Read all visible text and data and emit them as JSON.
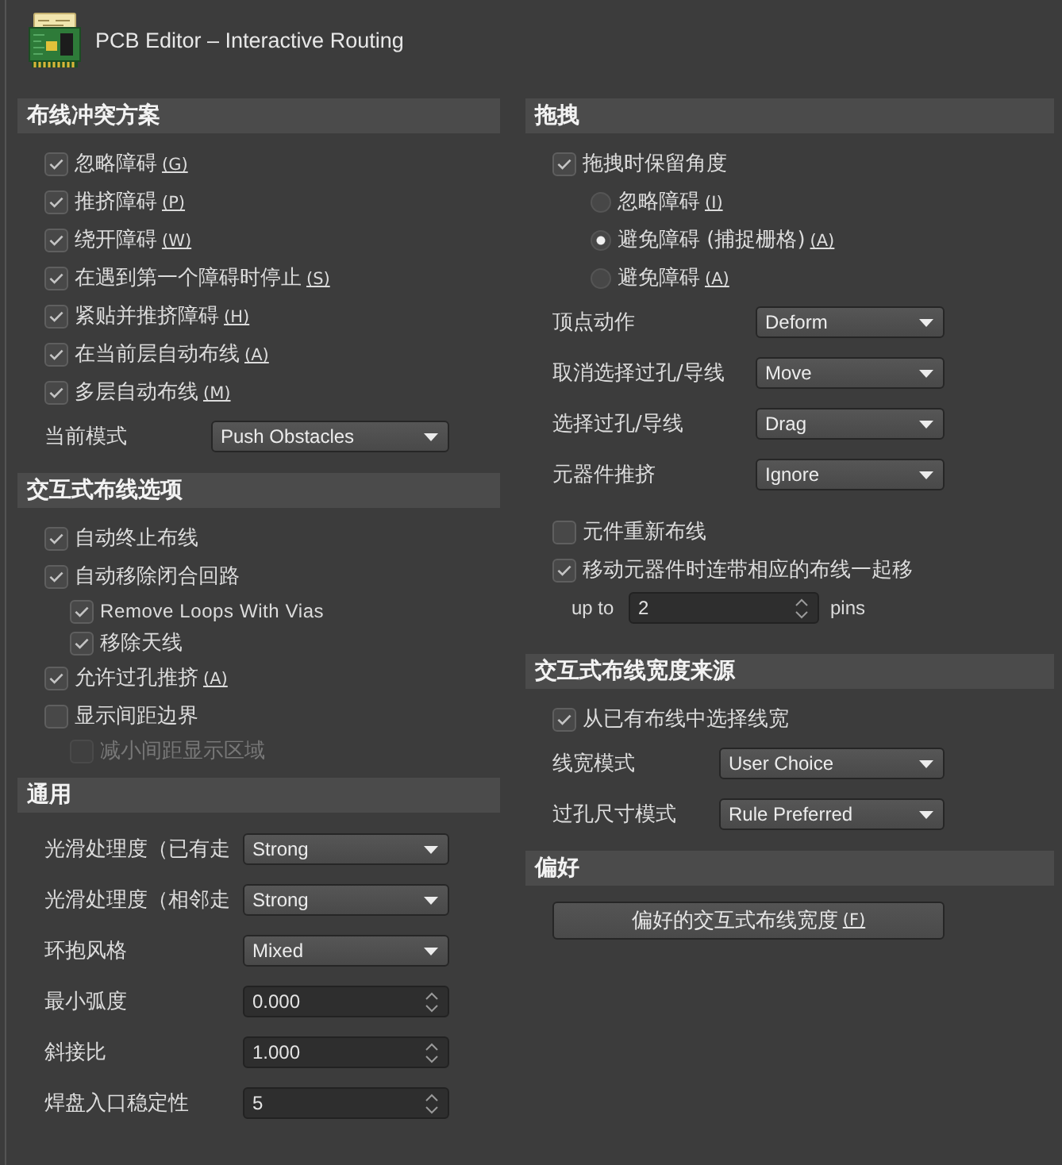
{
  "window": {
    "title": "PCB Editor – Interactive Routing"
  },
  "left_panel": {
    "sections": [
      {
        "title": "布线冲突方案",
        "items": [
          {
            "kind": "checkbox",
            "label": "忽略障碍",
            "shortcut": "(G)",
            "checked": true,
            "disabled": false
          },
          {
            "kind": "checkbox",
            "label": "推挤障碍",
            "shortcut": "(P)",
            "checked": true,
            "disabled": false
          },
          {
            "kind": "checkbox",
            "label": "绕开障碍",
            "shortcut": "(W)",
            "checked": true,
            "disabled": false
          },
          {
            "kind": "checkbox",
            "label": "在遇到第一个障碍时停止",
            "shortcut": "(S)",
            "checked": true,
            "disabled": false
          },
          {
            "kind": "checkbox",
            "label": "紧贴并推挤障碍",
            "shortcut": "(H)",
            "checked": true,
            "disabled": false
          },
          {
            "kind": "checkbox",
            "label": "在当前层自动布线",
            "shortcut": "(A)",
            "checked": true,
            "disabled": false
          },
          {
            "kind": "checkbox",
            "label": "多层自动布线",
            "shortcut": "(M)",
            "checked": true,
            "disabled": false
          },
          {
            "kind": "select",
            "label": "当前模式",
            "value": "Push Obstacles"
          }
        ]
      },
      {
        "title": "交互式布线选项",
        "items": [
          {
            "kind": "checkbox",
            "label": "自动终止布线",
            "checked": true,
            "disabled": false
          },
          {
            "kind": "checkbox",
            "label": "自动移除闭合回路",
            "checked": true,
            "disabled": false,
            "children": [
              {
                "kind": "checkbox",
                "label": "Remove Loops With Vias",
                "checked": true,
                "disabled": false
              },
              {
                "kind": "checkbox",
                "label": "移除天线",
                "checked": true,
                "disabled": false
              }
            ]
          },
          {
            "kind": "checkbox",
            "label": "允许过孔推挤",
            "shortcut": "(A)",
            "checked": true,
            "disabled": false
          },
          {
            "kind": "checkbox",
            "label": "显示间距边界",
            "checked": false,
            "disabled": false,
            "children": [
              {
                "kind": "checkbox",
                "label": "减小间距显示区域",
                "checked": false,
                "disabled": true
              }
            ]
          }
        ]
      },
      {
        "title": "通用",
        "items": [
          {
            "kind": "select",
            "label": "光滑处理度（已有走",
            "value": "Strong"
          },
          {
            "kind": "select",
            "label": "光滑处理度（相邻走",
            "value": "Strong"
          },
          {
            "kind": "select",
            "label": "环抱风格",
            "value": "Mixed"
          },
          {
            "kind": "spinner",
            "label": "最小弧度",
            "value": "0.000"
          },
          {
            "kind": "spinner",
            "label": "斜接比",
            "value": "1.000"
          },
          {
            "kind": "spinner",
            "label": "焊盘入口稳定性",
            "value": "5"
          }
        ]
      }
    ]
  },
  "right_panel": {
    "sections": [
      {
        "title": "拖拽",
        "items": [
          {
            "kind": "checkbox",
            "label": "拖拽时保留角度",
            "checked": true,
            "disabled": false,
            "children": [
              {
                "kind": "radio",
                "label": "忽略障碍",
                "shortcut": "(I)",
                "selected": false
              },
              {
                "kind": "radio",
                "label": "避免障碍 (捕捉栅格)",
                "shortcut": "(A)",
                "selected": true
              },
              {
                "kind": "radio",
                "label": "避免障碍",
                "shortcut": "(A)",
                "selected": false
              }
            ]
          },
          {
            "kind": "select",
            "label": "顶点动作",
            "value": "Deform"
          },
          {
            "kind": "select",
            "label": "取消选择过孔/导线",
            "value": "Move"
          },
          {
            "kind": "select",
            "label": "选择过孔/导线",
            "value": "Drag"
          },
          {
            "kind": "select",
            "label": "元器件推挤",
            "value": "Ignore"
          },
          {
            "kind": "checkbox",
            "label": "元件重新布线",
            "checked": false,
            "disabled": false
          },
          {
            "kind": "checkbox",
            "label": "移动元器件时连带相应的布线一起移",
            "checked": true,
            "disabled": false
          },
          {
            "kind": "count",
            "label": "up to",
            "value": "2",
            "unit": "pins"
          }
        ]
      },
      {
        "title": "交互式布线宽度来源",
        "items": [
          {
            "kind": "checkbox",
            "label": "从已有布线中选择线宽",
            "checked": true,
            "disabled": false
          },
          {
            "kind": "select",
            "label": "线宽模式",
            "value": "User Choice"
          },
          {
            "kind": "select",
            "label": "过孔尺寸模式",
            "value": "Rule Preferred"
          }
        ]
      },
      {
        "title": "偏好",
        "items": [
          {
            "kind": "button",
            "label": "偏好的交互式布线宽度",
            "shortcut": "(F)"
          }
        ]
      }
    ]
  }
}
